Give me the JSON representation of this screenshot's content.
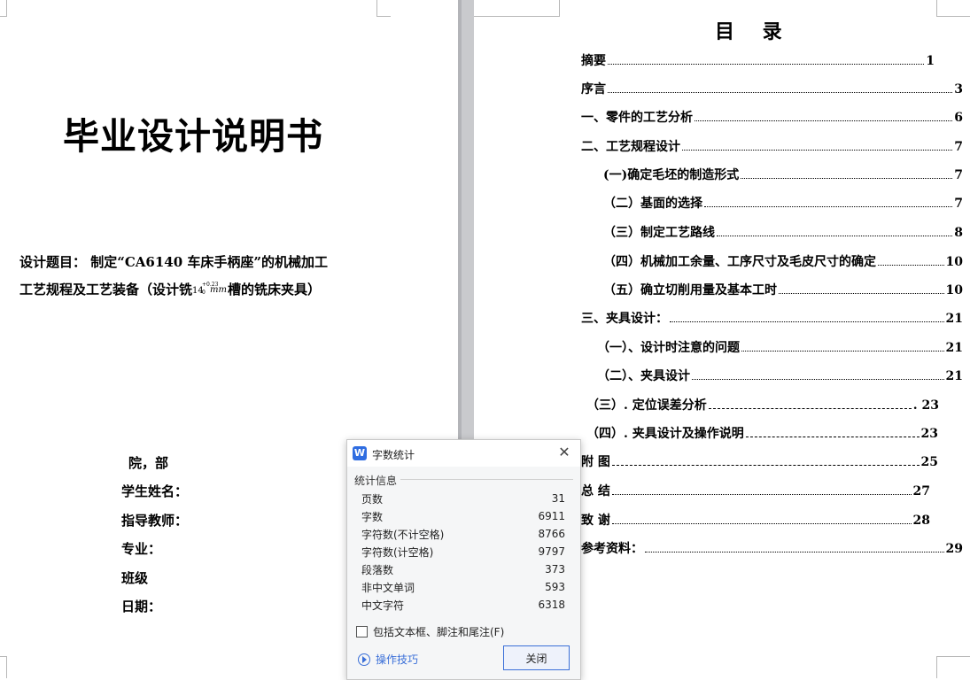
{
  "left_page": {
    "title": "毕业设计说明书",
    "topic_line1": "设计题目：    制定“CA6140 车床手柄座”的机械加工",
    "topic_line2_before": "工艺规程及工艺装备（设计铣",
    "tolerance": {
      "base": "14",
      "upper": "+0.23",
      "lower": "0",
      "unit": "mm"
    },
    "topic_line2_after": "槽的铣床夹具）",
    "labels": {
      "college": "院，部",
      "student_name": "学生姓名：",
      "advisor": "指导教师：",
      "major": "专业：",
      "class": "班级",
      "date": "日期："
    }
  },
  "right_page": {
    "toc_title": "目 录",
    "entries": [
      {
        "text": "摘要",
        "page": "1"
      },
      {
        "text": "序言",
        "page": "3"
      },
      {
        "text": "一、零件的工艺分析",
        "page": "6"
      },
      {
        "text": "二、工艺规程设计",
        "page": "7"
      },
      {
        "text": "(一)确定毛坯的制造形式",
        "page": "7"
      },
      {
        "text": "（二）基面的选择",
        "page": "7"
      },
      {
        "text": "（三）制定工艺路线",
        "page": "8"
      },
      {
        "text": "（四）机械加工余量、工序尺寸及毛皮尺寸的确定",
        "page": "10"
      },
      {
        "text": "（五）确立切削用量及基本工时",
        "page": "10"
      },
      {
        "text": "三、夹具设计：",
        "page": "21"
      },
      {
        "text": "（一）、设计时注意的问题",
        "page": "21"
      },
      {
        "text": "（二）、夹具设计",
        "page": "21"
      },
      {
        "text": "（三）. 定位误差分析",
        "page": ". 23"
      },
      {
        "text": "（四）. 夹具设计及操作说明",
        "page": "23"
      },
      {
        "text": "附  图",
        "page": "25"
      },
      {
        "text": "总   结",
        "page": "27"
      },
      {
        "text": "致   谢",
        "page": "28"
      },
      {
        "text": "参考资料：",
        "page": "29"
      }
    ]
  },
  "dialog": {
    "title": "字数统计",
    "logo_letter": "W",
    "stats_header": "统计信息",
    "stats": [
      {
        "label": "页数",
        "value": "31"
      },
      {
        "label": "字数",
        "value": "6911"
      },
      {
        "label": "字符数(不计空格)",
        "value": "8766"
      },
      {
        "label": "字符数(计空格)",
        "value": "9797"
      },
      {
        "label": "段落数",
        "value": "373"
      },
      {
        "label": "非中文单词",
        "value": "593"
      },
      {
        "label": "中文字符",
        "value": "6318"
      }
    ],
    "include_option": "包括文本框、脚注和尾注(F)",
    "include_checked": false,
    "tips_link": "操作技巧",
    "close_button": "关闭",
    "close_glyph": "✕"
  }
}
